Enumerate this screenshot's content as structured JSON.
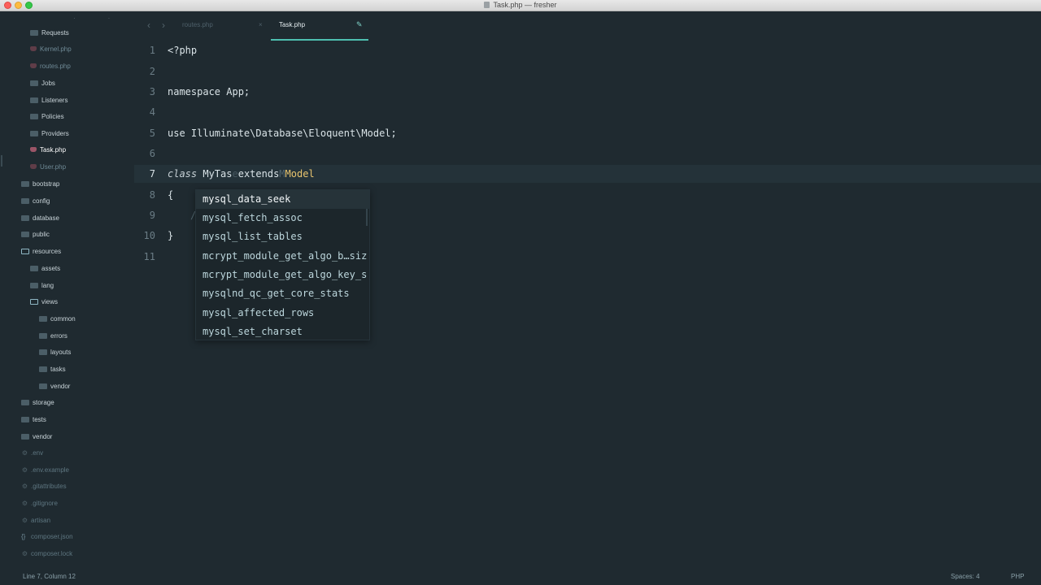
{
  "window": {
    "title": "Task.php — fresher"
  },
  "sidebar": {
    "items": [
      {
        "label": "Requests",
        "type": "folder"
      },
      {
        "label": "Kernel.php",
        "type": "file"
      },
      {
        "label": "routes.php",
        "type": "file"
      },
      {
        "label": "Jobs",
        "type": "folder"
      },
      {
        "label": "Listeners",
        "type": "folder"
      },
      {
        "label": "Policies",
        "type": "folder"
      },
      {
        "label": "Providers",
        "type": "folder"
      },
      {
        "label": "Task.php",
        "type": "file"
      },
      {
        "label": "User.php",
        "type": "file"
      },
      {
        "label": "bootstrap",
        "type": "folder"
      },
      {
        "label": "config",
        "type": "folder"
      },
      {
        "label": "database",
        "type": "folder"
      },
      {
        "label": "public",
        "type": "folder"
      },
      {
        "label": "resources",
        "type": "folder-open"
      },
      {
        "label": "assets",
        "type": "folder"
      },
      {
        "label": "lang",
        "type": "folder"
      },
      {
        "label": "views",
        "type": "folder-open"
      },
      {
        "label": "common",
        "type": "folder"
      },
      {
        "label": "errors",
        "type": "folder"
      },
      {
        "label": "layouts",
        "type": "folder"
      },
      {
        "label": "tasks",
        "type": "folder"
      },
      {
        "label": "vendor",
        "type": "folder"
      },
      {
        "label": "storage",
        "type": "folder"
      },
      {
        "label": "tests",
        "type": "folder"
      },
      {
        "label": "vendor",
        "type": "folder"
      },
      {
        "label": ".env",
        "type": "config"
      },
      {
        "label": ".env.example",
        "type": "config"
      },
      {
        "label": ".gitattributes",
        "type": "config"
      },
      {
        "label": ".gitignore",
        "type": "config"
      },
      {
        "label": "artisan",
        "type": "config"
      },
      {
        "label": "composer.json",
        "type": "json"
      },
      {
        "label": "composer.lock",
        "type": "config"
      }
    ]
  },
  "tabs": [
    {
      "label": "routes.php",
      "active": false
    },
    {
      "label": "Task.php",
      "active": true
    }
  ],
  "editor": {
    "line_numbers": [
      "1",
      "2",
      "3",
      "4",
      "5",
      "6",
      "7",
      "8",
      "9",
      "10",
      "11"
    ],
    "current_line": "7",
    "lines": {
      "l1": "<?php",
      "l3": "namespace App;",
      "l5": "use Illuminate\\Database\\Eloquent\\Model;",
      "l7_keyword": "class",
      "l7_name": " MyTas",
      "l7_cursor": "e",
      "l7_extends": "extends",
      "l7_ghost": "M",
      "l7_parent": "Model",
      "l8": "{",
      "l9": "/",
      "l10": "}"
    }
  },
  "autocomplete": {
    "items": [
      "mysql_data_seek",
      "mysql_fetch_assoc",
      "mysql_list_tables",
      "mcrypt_module_get_algo_b…siz",
      "mcrypt_module_get_algo_key_s",
      "mysqlnd_qc_get_core_stats",
      "mysql_affected_rows",
      "mysql_set_charset"
    ],
    "selected_index": 0
  },
  "statusbar": {
    "position": "Line 7, Column 12",
    "spaces": "Spaces: 4",
    "syntax": "PHP"
  },
  "colors": {
    "background": "#1f2a30",
    "accent": "#4ebfb0",
    "php_file_icon": "#9b5567",
    "class_name": "#e8c46e"
  }
}
